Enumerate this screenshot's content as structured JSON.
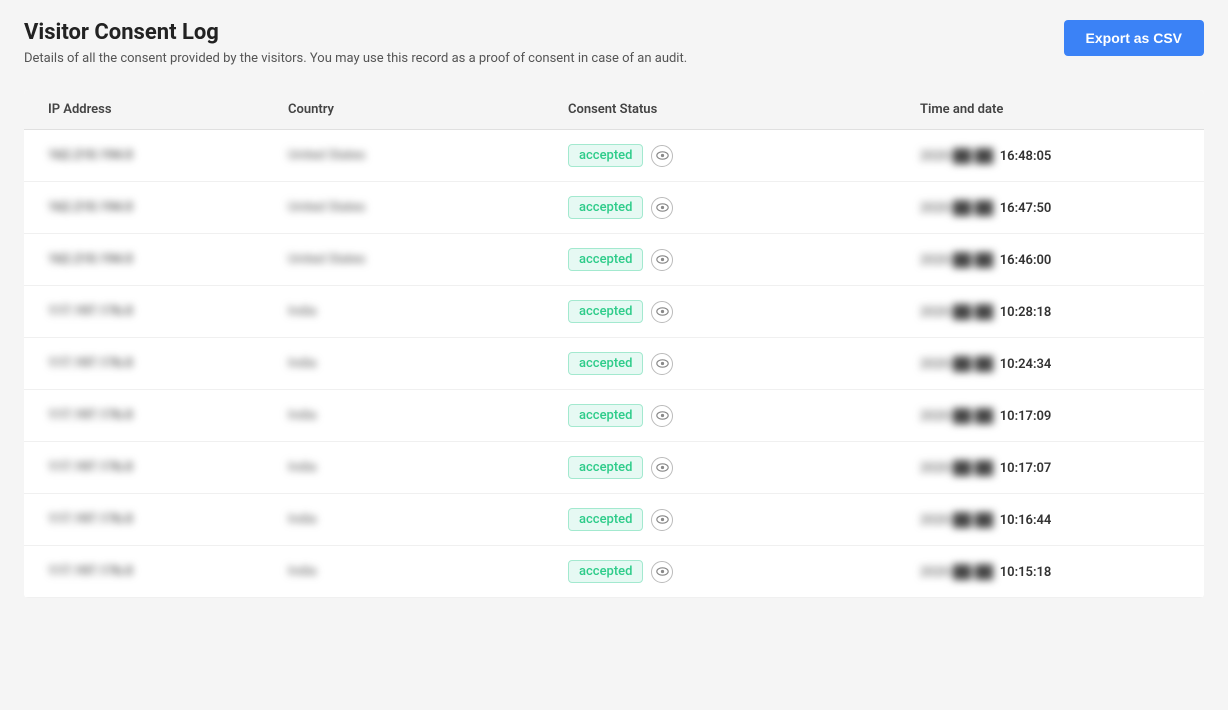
{
  "page": {
    "title": "Visitor Consent Log",
    "subtitle": "Details of all the consent provided by the visitors. You may use this record as a proof of consent in case of an audit."
  },
  "export_button": {
    "label": "Export as CSV"
  },
  "table": {
    "headers": [
      "IP Address",
      "Country",
      "Consent Status",
      "Time and date"
    ],
    "rows": [
      {
        "ip": "162.210.194.0",
        "country": "United States",
        "status": "accepted",
        "date_blurred": "2020-██-██",
        "time": "16:48:05"
      },
      {
        "ip": "162.210.194.0",
        "country": "United States",
        "status": "accepted",
        "date_blurred": "2020-██-██",
        "time": "16:47:50"
      },
      {
        "ip": "162.210.194.0",
        "country": "United States",
        "status": "accepted",
        "date_blurred": "2020-██-██",
        "time": "16:46:00"
      },
      {
        "ip": "117.197.176.0",
        "country": "India",
        "status": "accepted",
        "date_blurred": "2020-██-██",
        "time": "10:28:18"
      },
      {
        "ip": "117.197.176.0",
        "country": "India",
        "status": "accepted",
        "date_blurred": "2020-██-██",
        "time": "10:24:34"
      },
      {
        "ip": "117.197.176.0",
        "country": "India",
        "status": "accepted",
        "date_blurred": "2020-██-██",
        "time": "10:17:09"
      },
      {
        "ip": "117.197.176.0",
        "country": "India",
        "status": "accepted",
        "date_blurred": "2020-██-██",
        "time": "10:17:07"
      },
      {
        "ip": "117.197.176.0",
        "country": "India",
        "status": "accepted",
        "date_blurred": "2020-██-██",
        "time": "10:16:44"
      },
      {
        "ip": "117.197.176.0",
        "country": "India",
        "status": "accepted",
        "date_blurred": "2020-██-██",
        "time": "10:15:18"
      }
    ]
  }
}
